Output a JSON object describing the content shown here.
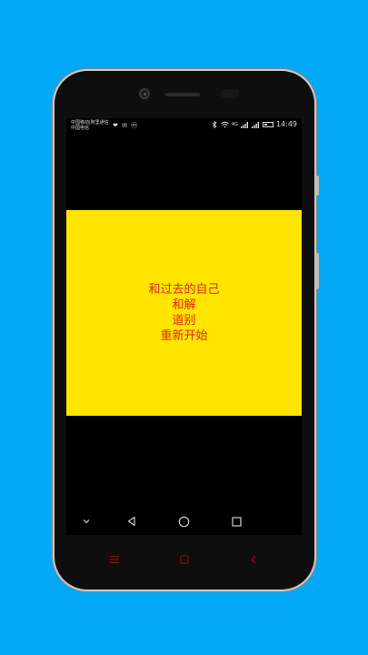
{
  "status_bar": {
    "carrier_line1": "中国移动|阿里通信",
    "carrier_line2": "中国电信",
    "left_icons": "❤ ✉ ⓜ",
    "network_text": "4G",
    "time": "14:49"
  },
  "content": {
    "background": "#ffe500",
    "text_color": "#e2231a",
    "lines": [
      "和过去的自己",
      "和解",
      "道别",
      "重新开始"
    ]
  },
  "nav_bar": {
    "buttons": [
      "chevron-down-icon",
      "back-icon",
      "home-icon",
      "recents-icon"
    ]
  },
  "hardware_keys": {
    "color": "#8b1010",
    "keys": [
      "menu-icon",
      "home-icon",
      "back-icon"
    ]
  },
  "page": {
    "background": "#03a9f4"
  }
}
